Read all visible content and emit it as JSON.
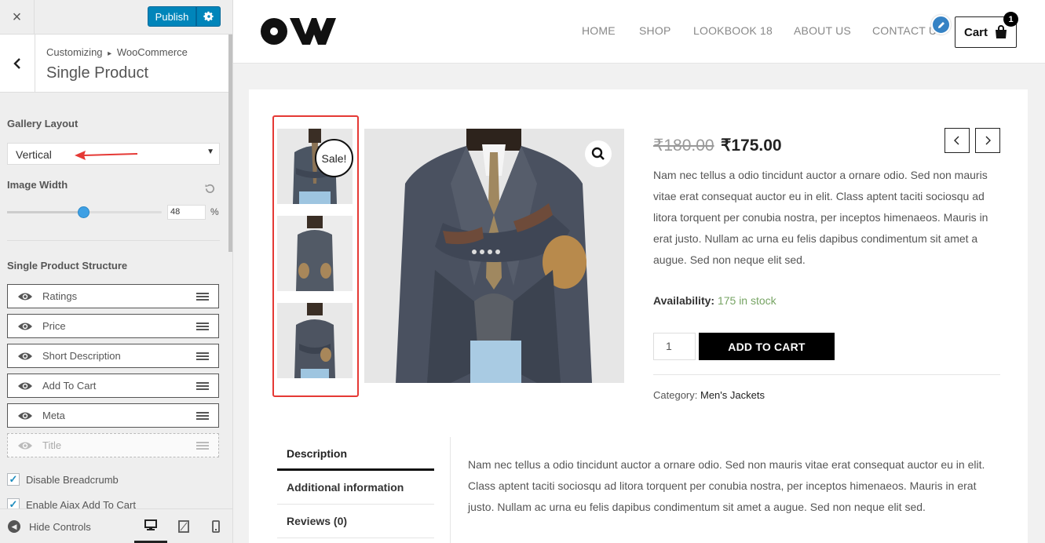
{
  "sidebar": {
    "close_glyph": "×",
    "publish_label": "Publish",
    "breadcrumb_root": "Customizing",
    "breadcrumb_sep": "▸",
    "breadcrumb_section": "WooCommerce",
    "section_title": "Single Product",
    "gallery_layout": {
      "label": "Gallery Layout",
      "value": "Vertical"
    },
    "image_width": {
      "label": "Image Width",
      "value": "48",
      "unit": "%",
      "level_fraction": 0.48
    },
    "structure": {
      "label": "Single Product Structure",
      "items": [
        {
          "label": "Ratings",
          "visible": true
        },
        {
          "label": "Price",
          "visible": true
        },
        {
          "label": "Short Description",
          "visible": true
        },
        {
          "label": "Add To Cart",
          "visible": true
        },
        {
          "label": "Meta",
          "visible": true
        },
        {
          "label": "Title",
          "visible": false
        }
      ]
    },
    "checkboxes": [
      {
        "label": "Disable Breadcrumb",
        "checked": true
      },
      {
        "label": "Enable Ajax Add To Cart",
        "checked": true
      }
    ],
    "footer": {
      "hide_controls_label": "Hide Controls"
    },
    "accent_color": "#0085ba",
    "arrow_color": "#e53935"
  },
  "site": {
    "nav": [
      "HOME",
      "SHOP",
      "LOOKBOOK 18",
      "ABOUT US",
      "CONTACT US"
    ],
    "cart_label": "Cart",
    "cart_count": "1"
  },
  "product": {
    "sale_badge": "Sale!",
    "old_price": "₹180.00",
    "new_price": "₹175.00",
    "short_description": "Nam nec tellus a odio tincidunt auctor a ornare odio. Sed non mauris vitae erat consequat auctor eu in elit. Class aptent taciti sociosqu ad litora torquent per conubia nostra, per inceptos himenaeos. Mauris in erat justo. Nullam ac urna eu felis dapibus condimentum sit amet a augue. Sed non neque elit sed.",
    "availability_label": "Availability:",
    "stock": "175 in stock",
    "quantity": "1",
    "add_to_cart_label": "ADD TO CART",
    "category_label": "Category:",
    "category": "Men's Jackets",
    "tabs": [
      "Description",
      "Additional information",
      "Reviews (0)"
    ],
    "description": "Nam nec tellus a odio tincidunt auctor a ornare odio. Sed non mauris vitae erat consequat auctor eu in elit. Class aptent taciti sociosqu ad litora torquent per conubia nostra, per inceptos himenaeos. Mauris in erat justo. Nullam ac urna eu felis dapibus condimentum sit amet a augue. Sed non neque elit sed.",
    "stock_color": "#77a464",
    "highlight_color": "#e53935"
  },
  "icons": {
    "close": "close-icon",
    "settings": "gear-icon",
    "back": "chevron-left-icon",
    "reset": "reset-icon",
    "visibility": "eye-icon",
    "drag": "drag-handle-icon",
    "edit": "pencil-icon",
    "cart": "shopping-bag-icon",
    "zoom": "search-icon",
    "prev": "chevron-left-icon",
    "next": "chevron-right-icon",
    "desktop": "desktop-icon",
    "tablet": "tablet-icon",
    "mobile": "mobile-icon"
  }
}
